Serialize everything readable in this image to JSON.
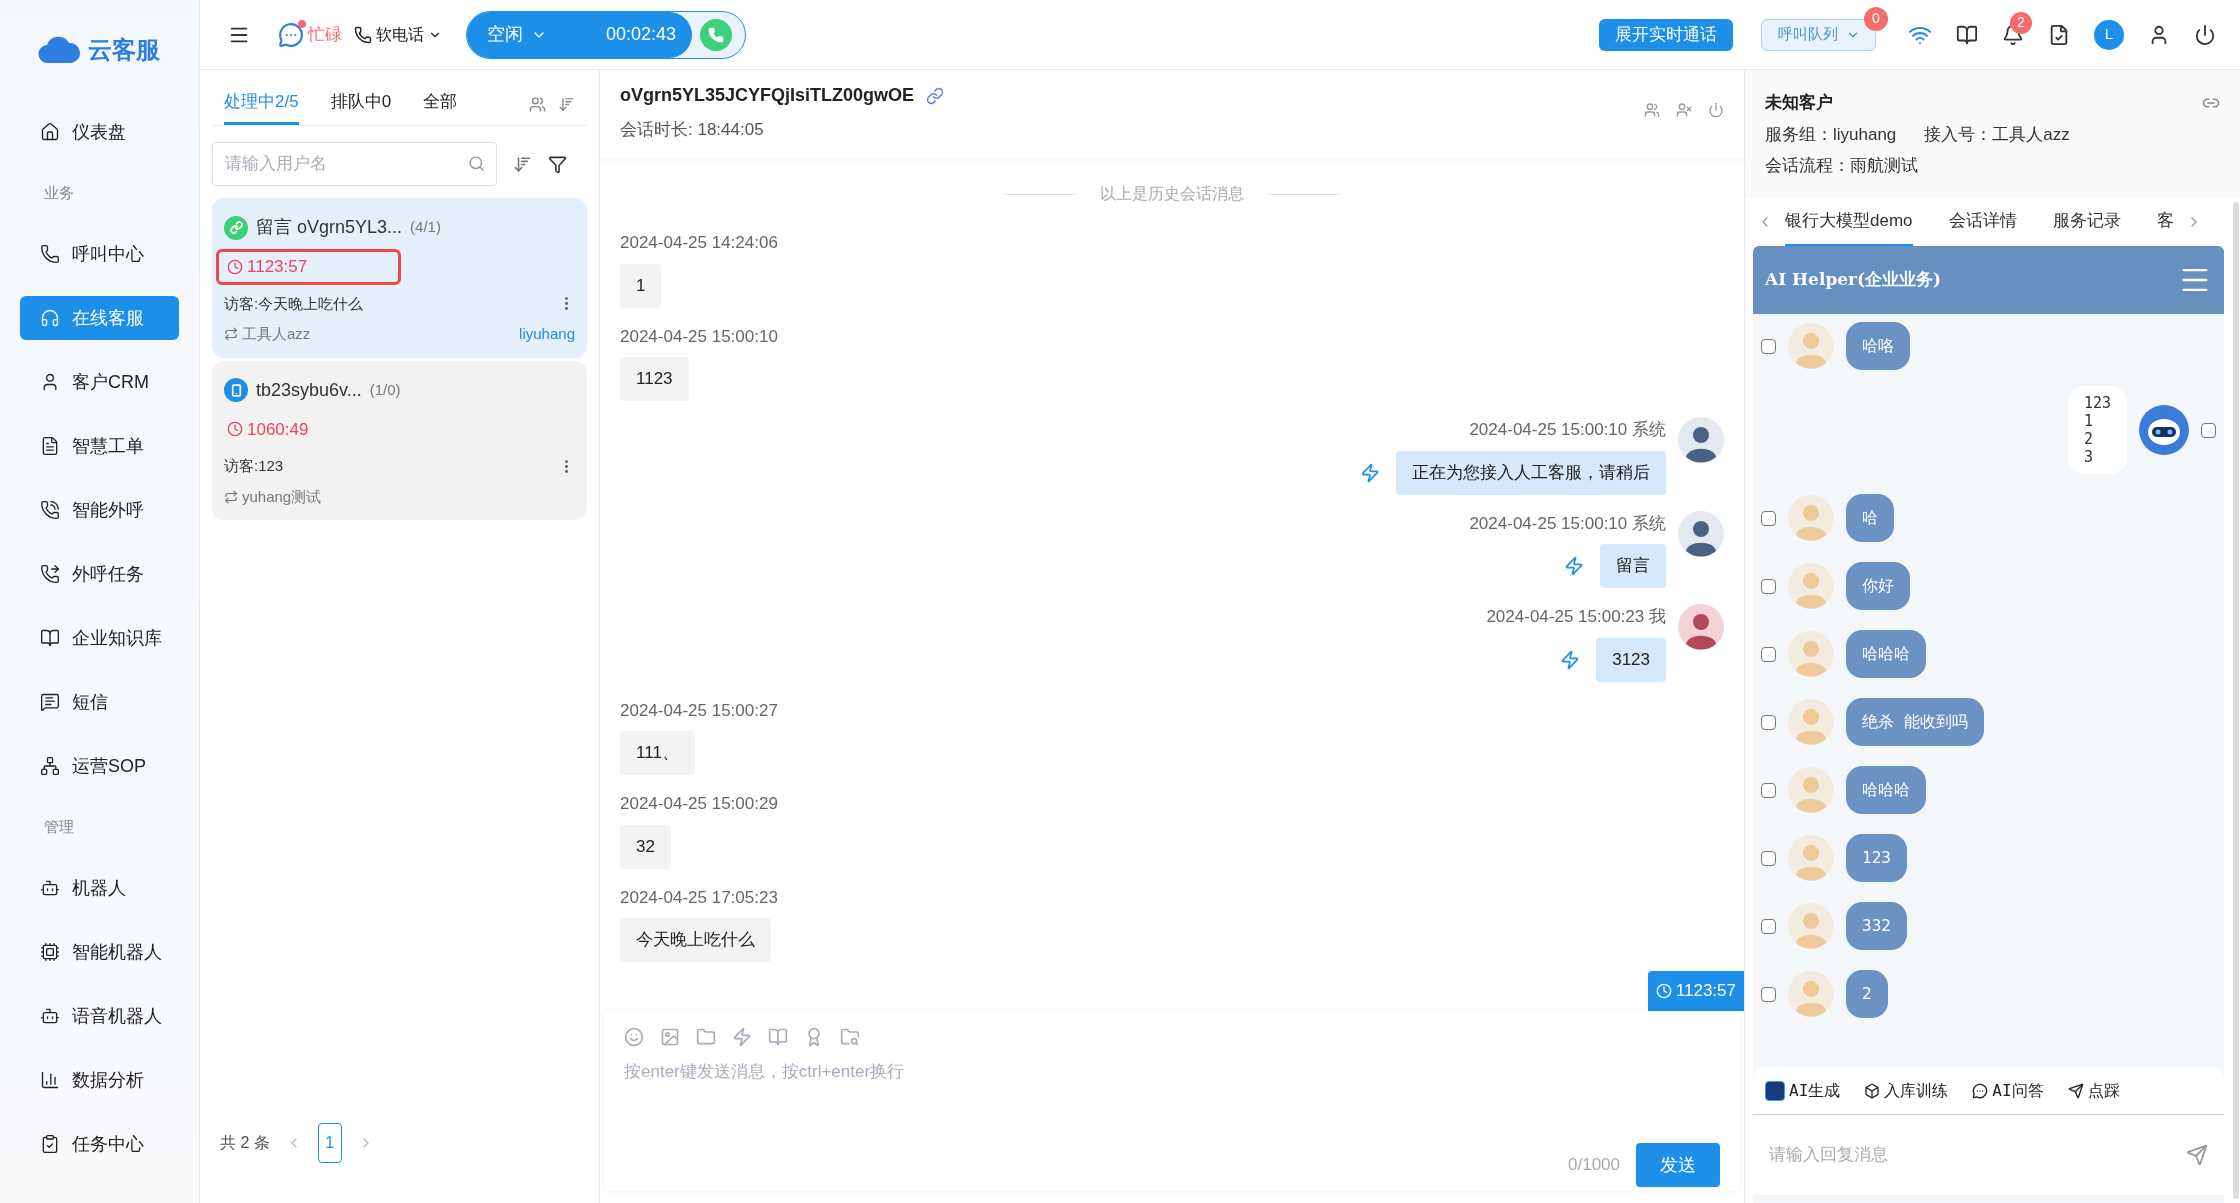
{
  "sidebar": {
    "logo": "云客服",
    "items": [
      {
        "kind": "item",
        "label": "仪表盘",
        "selected": false
      },
      {
        "kind": "section",
        "label": "业务"
      },
      {
        "kind": "item",
        "label": "呼叫中心",
        "selected": false
      },
      {
        "kind": "item",
        "label": "在线客服",
        "selected": true
      },
      {
        "kind": "item",
        "label": "客户CRM",
        "selected": false
      },
      {
        "kind": "item",
        "label": "智慧工单",
        "selected": false
      },
      {
        "kind": "item",
        "label": "智能外呼",
        "selected": false
      },
      {
        "kind": "item",
        "label": "外呼任务",
        "selected": false
      },
      {
        "kind": "item",
        "label": "企业知识库",
        "selected": false
      },
      {
        "kind": "item",
        "label": "短信",
        "selected": false
      },
      {
        "kind": "item",
        "label": "运营SOP",
        "selected": false
      },
      {
        "kind": "section",
        "label": "管理"
      },
      {
        "kind": "item",
        "label": "机器人",
        "selected": false
      },
      {
        "kind": "item",
        "label": "智能机器人",
        "selected": false
      },
      {
        "kind": "item",
        "label": "语音机器人",
        "selected": false
      },
      {
        "kind": "item",
        "label": "数据分析",
        "selected": false
      },
      {
        "kind": "item",
        "label": "任务中心",
        "selected": false
      }
    ]
  },
  "topbar": {
    "status": "忙碌",
    "phone_mode": "软电话",
    "agent_state": "空闲",
    "timer": "00:02:43",
    "live_call_button": "展开实时通话",
    "queue": {
      "label": "呼叫队列",
      "badge": "0"
    },
    "notifications_badge": "2",
    "avatar_letter": "L"
  },
  "session_list": {
    "tabs": [
      {
        "label": "处理中2/5",
        "selected": true
      },
      {
        "label": "排队中0",
        "selected": false
      },
      {
        "label": "全部",
        "selected": false
      }
    ],
    "search": {
      "placeholder": "请输入用户名"
    },
    "sessions": [
      {
        "kind": "mini",
        "title": "留言 oVgrn5YL3...",
        "count": "(4/1)",
        "timer": "1123:57",
        "highlighted": true,
        "last_message": "访客:今天晚上吃什么",
        "source": "工具人azz",
        "agent": "liyuhang",
        "selected": true
      },
      {
        "kind": "app",
        "title": "tb23sybu6v...",
        "count": "(1/0)",
        "timer": "1060:49",
        "highlighted": false,
        "last_message": "访客:123",
        "source": "yuhang测试",
        "selected": false
      }
    ],
    "pagination": {
      "total": "共 2 条",
      "pages": [
        {
          "label": "1",
          "selected": true
        }
      ]
    }
  },
  "chat": {
    "title": "oVgrn5YL35JCYFQjIsiTLZ00gwOE",
    "duration": "会话时长: 18:44:05",
    "history_divider": "以上是历史会话消息",
    "messages": [
      {
        "kind": "visitor",
        "time": "2024-04-25 14:24:06",
        "text": "1"
      },
      {
        "kind": "visitor",
        "time": "2024-04-25 15:00:10",
        "text": "1123"
      },
      {
        "kind": "system",
        "time": "2024-04-25 15:00:10",
        "sender": "系统",
        "text": "正在为您接入人工客服，请稍后"
      },
      {
        "kind": "system",
        "time": "2024-04-25 15:00:10",
        "sender": "系统",
        "text": "留言"
      },
      {
        "kind": "agent",
        "time": "2024-04-25 15:00:23",
        "sender": "我",
        "text": "3123"
      },
      {
        "kind": "visitor",
        "time": "2024-04-25 15:00:27",
        "text": "111、"
      },
      {
        "kind": "visitor",
        "time": "2024-04-25 15:00:29",
        "text": "32"
      },
      {
        "kind": "visitor",
        "time": "2024-04-25 17:05:23",
        "text": "今天晚上吃什么"
      }
    ],
    "wait_timer": "1123:57",
    "input": {
      "placeholder": "按enter键发送消息，按ctrl+enter换行",
      "counter": "0/1000",
      "send": "发送"
    }
  },
  "customer": {
    "name": "未知客户",
    "service_group": "服务组：liyuhang",
    "access_number": "接入号：工具人azz",
    "flow": "会话流程：雨航测试"
  },
  "side_tabs": [
    {
      "label": "银行大模型demo",
      "selected": true
    },
    {
      "label": "会话详情",
      "selected": false
    },
    {
      "label": "服务记录",
      "selected": false
    },
    {
      "label": "客",
      "selected": false
    }
  ],
  "ai_helper": {
    "title": "AI Helper(企业业务)",
    "messages": [
      {
        "kind": "user",
        "text": "哈咯",
        "checked": false
      },
      {
        "kind": "bot",
        "text": "123\n1\n2\n3",
        "checked": false
      },
      {
        "kind": "user",
        "text": "哈",
        "checked": false
      },
      {
        "kind": "user",
        "text": "你好",
        "checked": false
      },
      {
        "kind": "user",
        "text": "哈哈哈",
        "checked": false
      },
      {
        "kind": "user",
        "text": "绝杀 能收到吗",
        "checked": false
      },
      {
        "kind": "user",
        "text": "哈哈哈",
        "checked": false
      },
      {
        "kind": "user",
        "text": "123",
        "checked": false
      },
      {
        "kind": "user",
        "text": "332",
        "checked": false
      },
      {
        "kind": "user",
        "text": "2",
        "checked": false
      }
    ],
    "actions": [
      "AI生成",
      "入库训练",
      "AI问答",
      "点踩"
    ],
    "input": {
      "placeholder": "请输入回复消息"
    }
  }
}
